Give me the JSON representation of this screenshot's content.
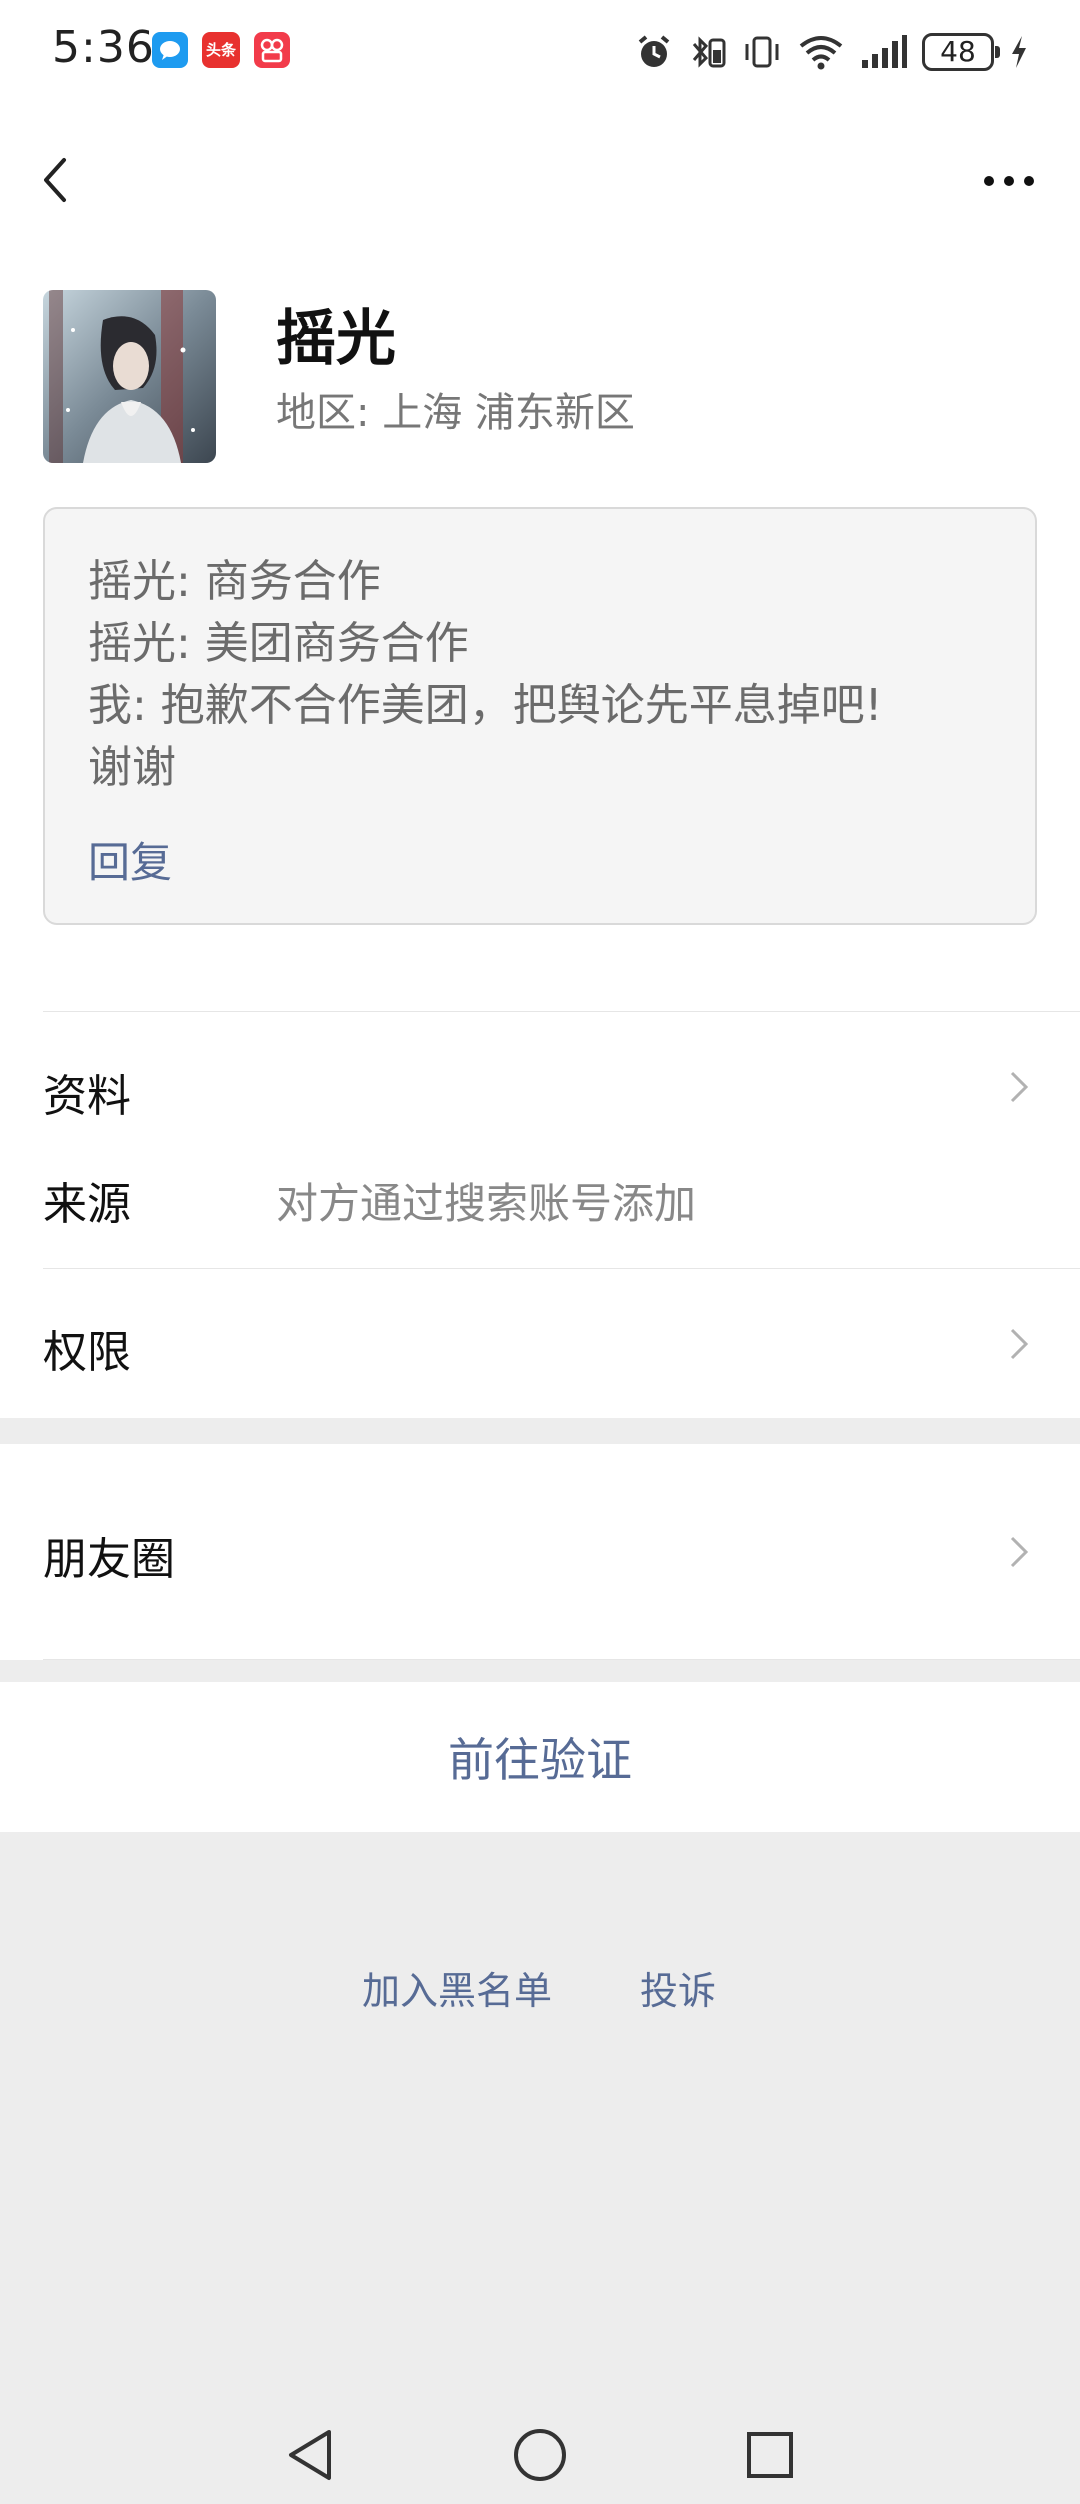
{
  "status_bar": {
    "time": "5:36",
    "battery": "48",
    "app_icons": [
      {
        "name": "message-app-icon",
        "color": "#1e9bf0"
      },
      {
        "name": "toutiao-app-icon",
        "color": "#e8312f",
        "text": "头条"
      },
      {
        "name": "video-app-icon",
        "color": "#f23b4a"
      }
    ]
  },
  "nav": {
    "back_icon": "chevron-left-icon",
    "more_icon": "more-dots-icon"
  },
  "profile": {
    "name": "摇光",
    "region": "地区:  上海  浦东新区"
  },
  "message_box": {
    "lines": [
      "摇光: 商务合作",
      "摇光: 美团商务合作",
      "我: 抱歉不合作美团，把舆论先平息掉吧!",
      "谢谢"
    ],
    "reply": "回复"
  },
  "rows": {
    "profile_info": "资料",
    "source_label": "来源",
    "source_value": "对方通过搜索账号添加",
    "permissions": "权限",
    "moments": "朋友圈"
  },
  "verify_button": "前往验证",
  "bottom_links": {
    "blacklist": "加入黑名单",
    "report": "投诉"
  },
  "colors": {
    "link": "#576b95",
    "background": "#ededed"
  }
}
